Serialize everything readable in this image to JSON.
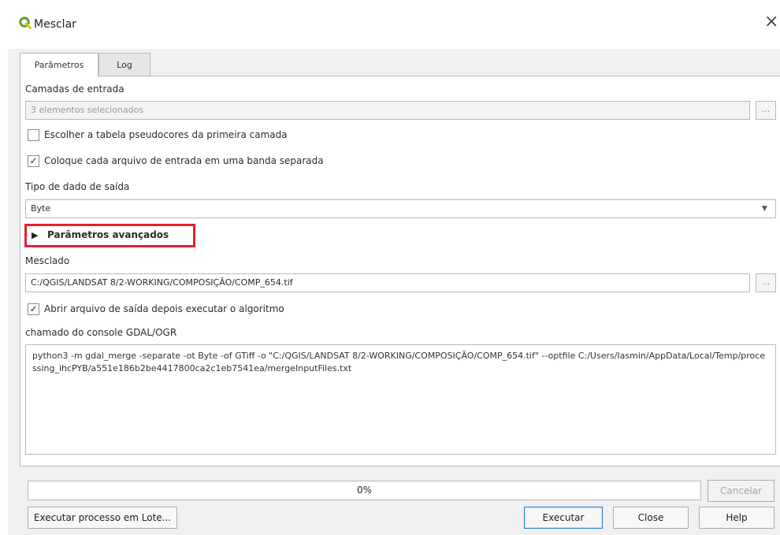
{
  "window": {
    "title": "Mesclar",
    "close_glyph": "×"
  },
  "tabs": [
    {
      "label": "Parâmetros"
    },
    {
      "label": "Log"
    }
  ],
  "params": {
    "input_layers_label": "Camadas de entrada",
    "input_layers_value": "3 elementos selecionados",
    "browse_label": "...",
    "pseudocolor_label": "Escolher a tabela pseudocores da primeira camada",
    "pseudocolor_checked": false,
    "separate_label": "Coloque cada arquivo de entrada em uma banda separada",
    "separate_checked": true,
    "output_type_label": "Tipo de dado de saída",
    "output_type_value": "Byte",
    "advanced_label": "Parâmetros avançados",
    "merged_label": "Mesclado",
    "merged_value": "C:/QGIS/LANDSAT 8/2-WORKING/COMPOSIÇÃO/COMP_654.tif",
    "open_output_label": "Abrir arquivo de saída depois executar o algoritmo",
    "open_output_checked": true,
    "console_label": "chamado do console GDAL/OGR",
    "console_text": "python3 -m gdal_merge -separate -ot Byte -of GTiff -o \"C:/QGIS/LANDSAT 8/2-WORKING/COMPOSIÇÃO/COMP_654.tif\" --optfile C:/Users/Iasmin/AppData/Local/Temp/processing_ihcPYB/a551e186b2be4417800ca2c1eb7541ea/mergeInputFiles.txt"
  },
  "footer": {
    "progress_text": "0%",
    "progress_value": 0,
    "cancel_label": "Cancelar",
    "batch_label": "Executar processo em Lote...",
    "run_label": "Executar",
    "close_label": "Close",
    "help_label": "Help"
  },
  "icons": {
    "app": "qgis-logo-icon",
    "check": "✓",
    "triangle": "▶",
    "dropdown": "▼"
  },
  "colors": {
    "highlight": "#e0212f",
    "qgis_green": "#5a9e2f",
    "accent_blue": "#2a7de1"
  }
}
